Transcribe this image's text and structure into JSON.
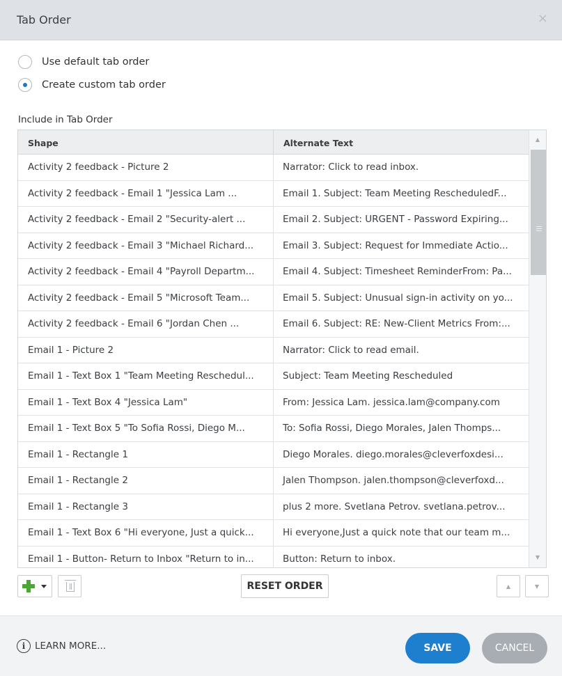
{
  "dialog": {
    "title": "Tab Order",
    "close_glyph": "×"
  },
  "options": {
    "default_label": "Use default tab order",
    "custom_label": "Create custom tab order",
    "selected": "custom"
  },
  "section_label": "Include in Tab Order",
  "table": {
    "columns": [
      "Shape",
      "Alternate Text"
    ],
    "rows": [
      {
        "shape": "Activity 2 feedback - Picture 2",
        "alt": "Narrator: Click to read inbox."
      },
      {
        "shape": "Activity 2 feedback - Email 1 \"Jessica Lam       ...",
        "alt": "Email 1. Subject: Team Meeting RescheduledF..."
      },
      {
        "shape": "Activity 2 feedback - Email 2 \"Security-alert     ...",
        "alt": "Email 2. Subject: URGENT - Password Expiring..."
      },
      {
        "shape": "Activity 2 feedback - Email 3 \"Michael Richard...",
        "alt": "Email 3. Subject: Request for Immediate Actio..."
      },
      {
        "shape": "Activity 2 feedback - Email 4 \"Payroll Departm...",
        "alt": "Email 4. Subject: Timesheet ReminderFrom: Pa..."
      },
      {
        "shape": "Activity 2 feedback - Email 5 \"Microsoft Team...",
        "alt": "Email 5. Subject: Unusual sign-in activity on yo..."
      },
      {
        "shape": "Activity 2 feedback - Email 6 \"Jordan Chen      ...",
        "alt": "Email 6. Subject: RE: New-Client Metrics From:..."
      },
      {
        "shape": "Email 1 - Picture 2",
        "alt": "Narrator: Click to read email."
      },
      {
        "shape": "Email 1 - Text Box 1 \"Team Meeting Reschedul...",
        "alt": "Subject: Team Meeting Rescheduled"
      },
      {
        "shape": "Email 1 - Text Box 4 \"Jessica Lam\"",
        "alt": "From: Jessica Lam. jessica.lam@company.com"
      },
      {
        "shape": "Email 1 - Text Box 5 \"To Sofia Rossi, Diego M...",
        "alt": "To: Sofia Rossi, Diego Morales, Jalen Thomps..."
      },
      {
        "shape": "Email 1 - Rectangle 1",
        "alt": "Diego Morales. diego.morales@cleverfoxdesi..."
      },
      {
        "shape": "Email 1 - Rectangle 2",
        "alt": "Jalen Thompson. jalen.thompson@cleverfoxd..."
      },
      {
        "shape": "Email 1 - Rectangle 3",
        "alt": "plus 2 more. Svetlana Petrov. svetlana.petrov..."
      },
      {
        "shape": "Email 1 - Text Box 6 \"Hi everyone, Just a quick...",
        "alt": "Hi everyone,Just a quick note that our team m..."
      },
      {
        "shape": "Email 1 - Button- Return to Inbox \"Return to in...",
        "alt": "Button: Return to inbox."
      }
    ]
  },
  "toolbar": {
    "reset_label": "RESET ORDER",
    "up_glyph": "▲",
    "down_glyph": "▼"
  },
  "footer": {
    "learn_more_label": "LEARN MORE...",
    "info_glyph": "i",
    "save_label": "SAVE",
    "cancel_label": "CANCEL"
  },
  "colors": {
    "accent": "#1f7fcf",
    "add_icon": "#4aa832",
    "cancel_bg": "#a7adb3"
  }
}
